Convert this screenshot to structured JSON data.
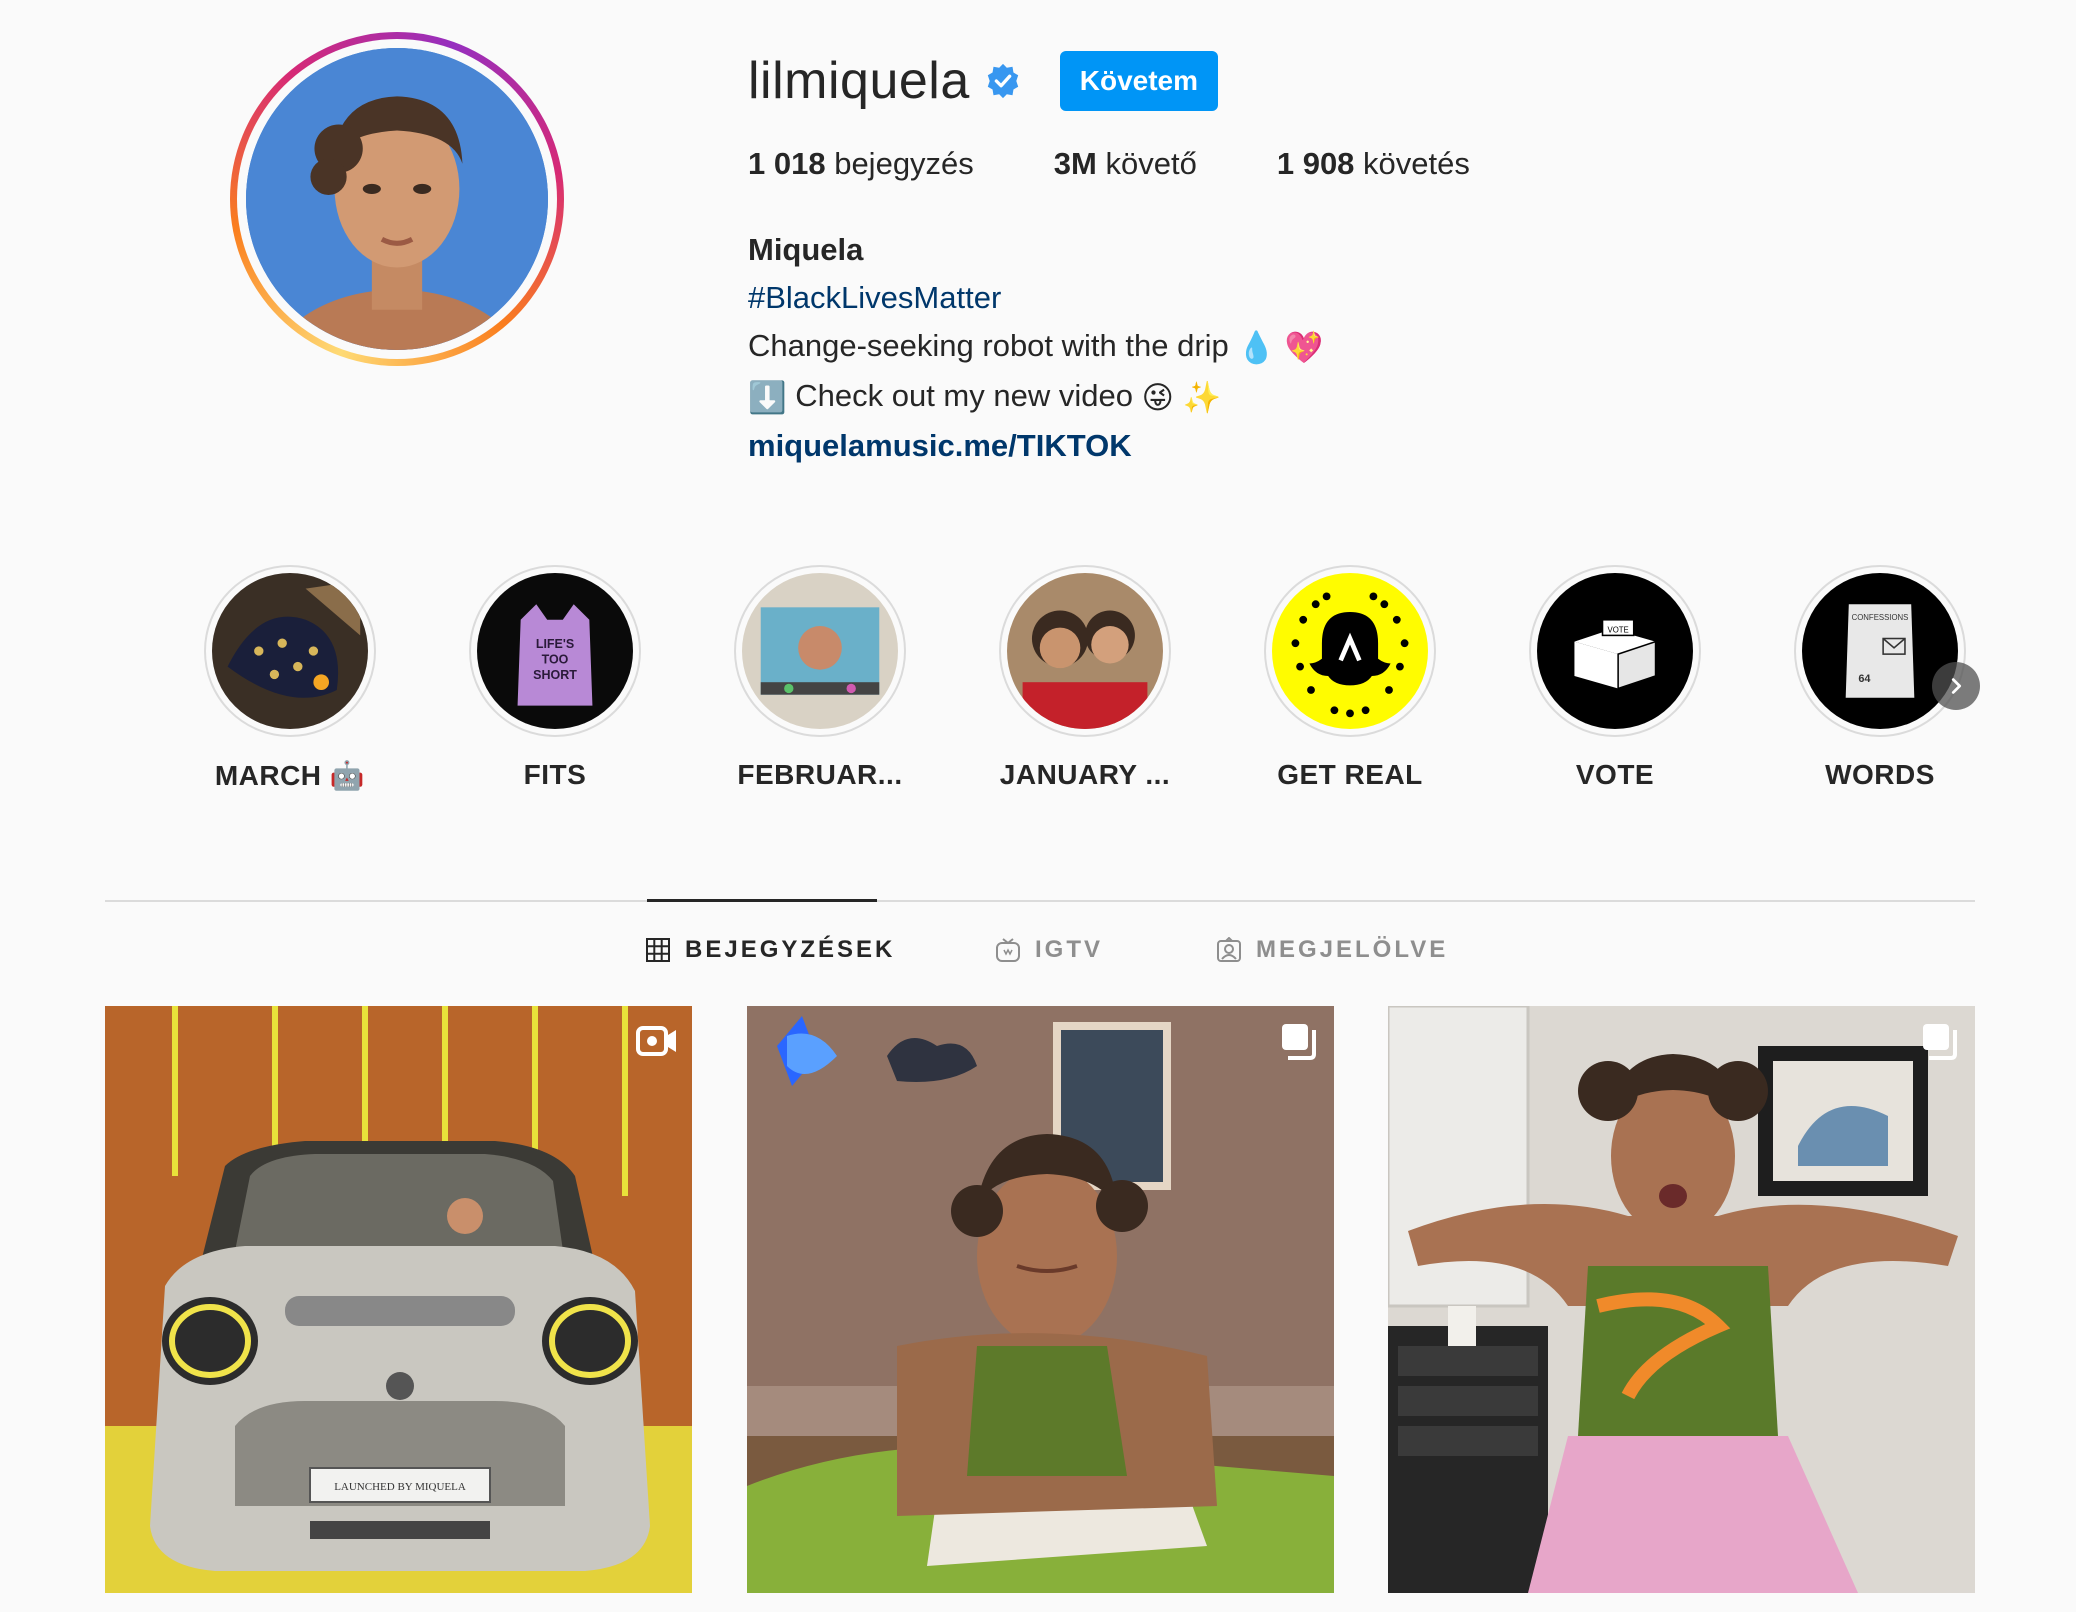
{
  "profile": {
    "username": "lilmiquela",
    "follow_button": "Követem",
    "stats": [
      {
        "count": "1 018",
        "label": "bejegyzés"
      },
      {
        "count": "3M",
        "label": "követő"
      },
      {
        "count": "1 908",
        "label": "követés"
      }
    ],
    "bio": {
      "name": "Miquela",
      "hashtag": "#BlackLivesMatter",
      "line1": "Change-seeking robot with the drip",
      "line1_emoji": "💧 💖",
      "line2_prefix_emoji": "⬇️",
      "line2": "Check out my new video",
      "line2_emoji": "😜 ✨",
      "link": "miquelamusic.me/TIKTOK"
    }
  },
  "highlights": [
    {
      "label": "MARCH 🤖",
      "icon": "gloves-image"
    },
    {
      "label": "FITS",
      "icon": "bag-image"
    },
    {
      "label": "FEBRUAR...",
      "icon": "tv-image"
    },
    {
      "label": "JANUARY ...",
      "icon": "friends-image"
    },
    {
      "label": "GET REAL",
      "icon": "snapcode-image"
    },
    {
      "label": "VOTE",
      "icon": "ballot-box-icon"
    },
    {
      "label": "WORDS",
      "icon": "sd-card-image"
    }
  ],
  "tabs": [
    {
      "label": "BEJEGYZÉSEK",
      "icon": "grid-icon",
      "active": true
    },
    {
      "label": "IGTV",
      "icon": "igtv-icon",
      "active": false
    },
    {
      "label": "MEGJELÖLVE",
      "icon": "tagged-icon",
      "active": false
    }
  ],
  "posts": [
    {
      "type": "video",
      "icon": "video-icon",
      "plate_text": "LAUNCHED BY MIQUELA"
    },
    {
      "type": "carousel",
      "icon": "carousel-icon"
    },
    {
      "type": "carousel",
      "icon": "carousel-icon"
    }
  ],
  "colors": {
    "accent": "#0095f6",
    "link": "#00376b",
    "text": "#262626",
    "muted": "#8e8e8e",
    "border": "#dbdbdb",
    "background": "#fafafa"
  }
}
